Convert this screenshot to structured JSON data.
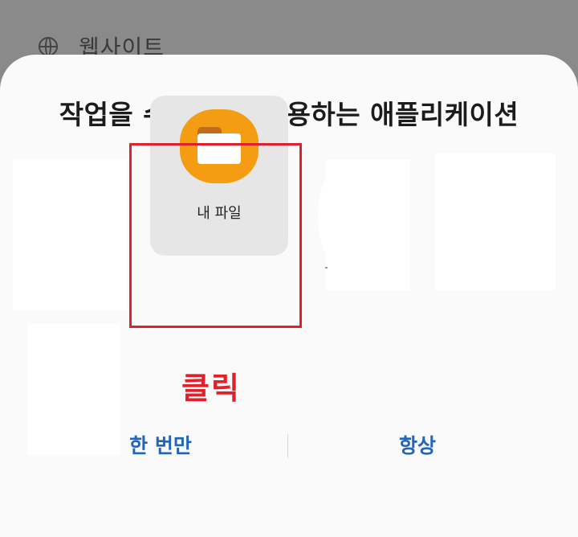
{
  "background": {
    "item_label": "웹사이트",
    "icon": "globe-icon"
  },
  "sheet": {
    "title": "작업을 수행할 때 사용하는 애플리케이션",
    "selected_app": {
      "label": "내 파일",
      "icon": "my-files-folder-icon",
      "icon_color": "#f49d12"
    },
    "annotation": "클릭",
    "annotation_color": "#e0202a",
    "buttons": {
      "just_once": "한 번만",
      "always": "항상"
    },
    "button_color": "#2565b8"
  }
}
